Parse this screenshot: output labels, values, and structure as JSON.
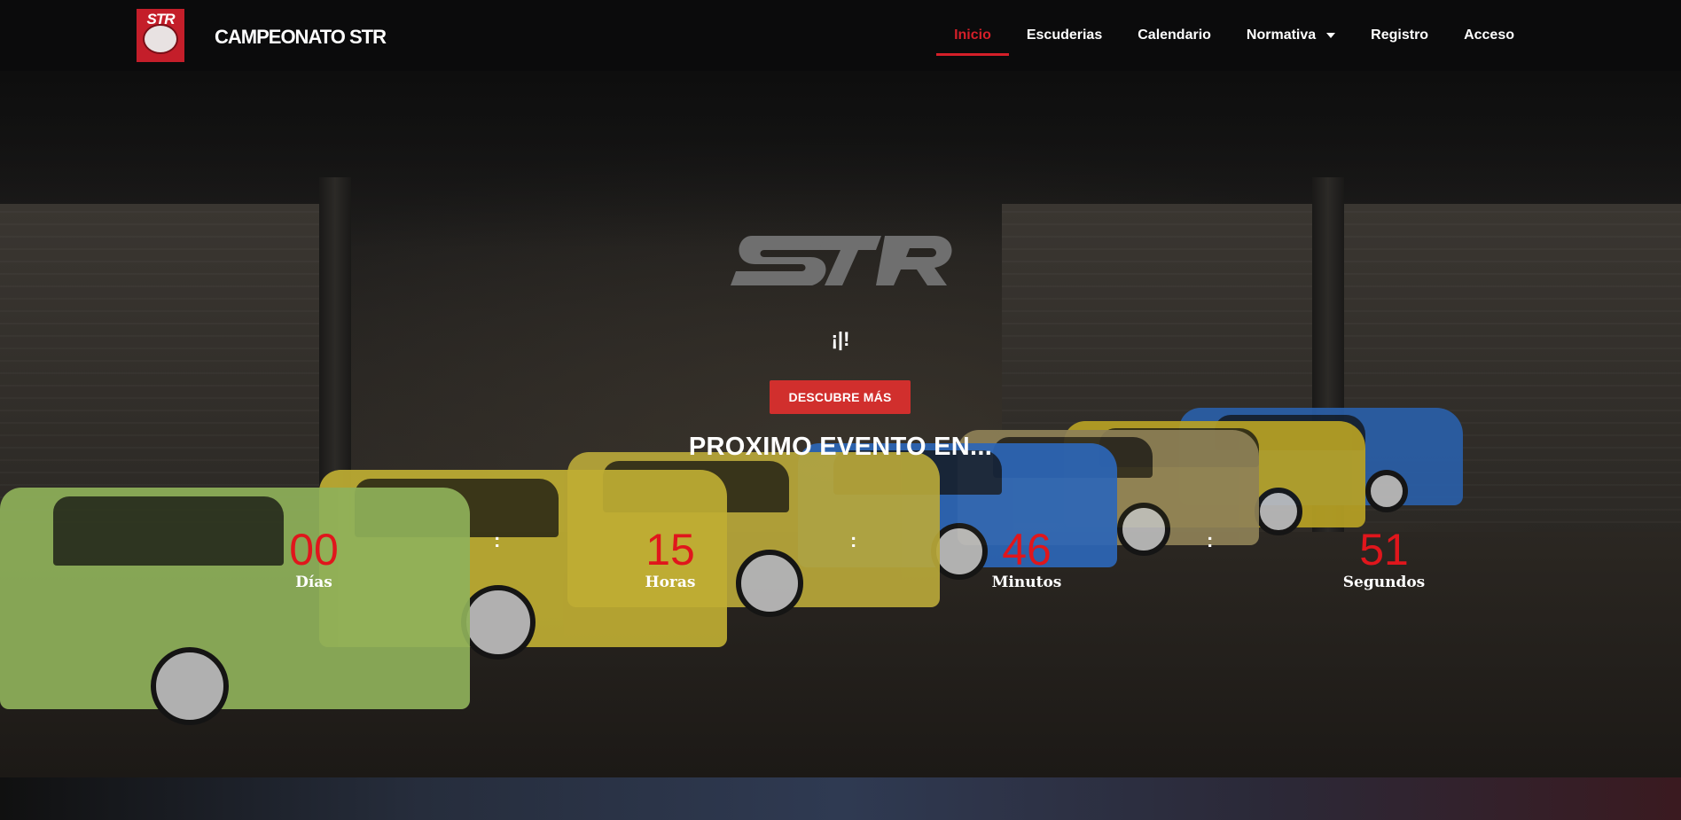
{
  "header": {
    "logo_text": "STR",
    "brand": "CAMPEONATO STR",
    "nav": [
      {
        "label": "Inicio",
        "active": true
      },
      {
        "label": "Escuderias",
        "active": false
      },
      {
        "label": "Calendario",
        "active": false
      },
      {
        "label": "Normativa",
        "active": false,
        "has_dropdown": true
      },
      {
        "label": "Registro",
        "active": false
      },
      {
        "label": "Acceso",
        "active": false
      }
    ]
  },
  "hero": {
    "logo_text": "STR",
    "tagline": "¡|!",
    "cta_label": "DESCUBRE MÁS",
    "event_title": "PROXIMO EVENTO EN...",
    "countdown": {
      "days": "00",
      "days_label": "Días",
      "hours": "15",
      "hours_label": "Horas",
      "minutes": "46",
      "minutes_label": "Minutos",
      "seconds": "51",
      "seconds_label": "Segundos",
      "separator": ":"
    }
  },
  "colors": {
    "accent": "#d51f29",
    "cta_background": "#d12f2d",
    "countdown_number": "#e0161c",
    "header_background": "#0b0b0c"
  }
}
